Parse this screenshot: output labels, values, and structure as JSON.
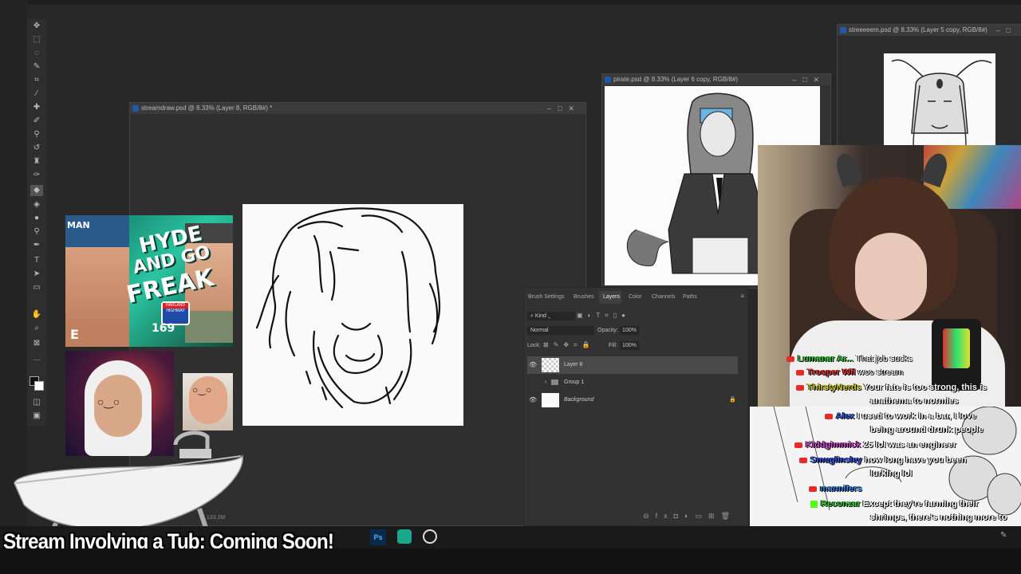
{
  "doc_windows": {
    "streamdraw": {
      "title": "streamdraw.psd @ 8.33% (Layer 8, RGB/8#) *",
      "status": "133.2M"
    },
    "pirate": {
      "title": "pirate.psd @ 8.33% (Layer 6 copy, RGB/8#)"
    },
    "streeeeem": {
      "title": "streeeeem.psd @ 8.33% (Layer 5 copy, RGB/8#)"
    }
  },
  "panel": {
    "tabs": [
      "Brush Settings",
      "Brushes",
      "Layers",
      "Color",
      "Channels",
      "Paths"
    ],
    "active_tab": "Layers",
    "filter_kind": "Kind",
    "blend_mode": "Normal",
    "opacity_label": "Opacity:",
    "opacity_value": "100%",
    "lock_label": "Lock:",
    "fill_label": "Fill:",
    "fill_value": "100%",
    "layers": [
      {
        "name": "Layer 8",
        "visible": true,
        "selected": true
      },
      {
        "name": "Group 1",
        "visible": false,
        "selected": false
      },
      {
        "name": "Background",
        "visible": true,
        "selected": false
      }
    ]
  },
  "thumbnail": {
    "cap_text": "MAN",
    "title_line1": "HYDE",
    "title_line2": "AND GO",
    "title_line3": "FREAK",
    "badge_line1": "HARLAND",
    "badge_line2": "HIGHWAY",
    "episode": "169",
    "left_text": "E"
  },
  "chat": {
    "messages": [
      {
        "platform": "youtube",
        "user": "Lumanar Ar...",
        "text": "That job sucks",
        "user_color": "#3ad13a"
      },
      {
        "platform": "youtube",
        "user": "Trooper Wil",
        "text": "woo stream",
        "user_color": "#e63939"
      },
      {
        "platform": "youtube",
        "user": "ThirstyNerds",
        "text": "Your fate is too strong, this is",
        "user_color": "#d8d02a"
      },
      {
        "platform": "none",
        "user": "",
        "text": "anathema to normies",
        "user_color": "#ffffff"
      },
      {
        "platform": "youtube",
        "user": "Alex",
        "text": "I used to work in a bar, I love",
        "user_color": "#3a5ae6"
      },
      {
        "platform": "none",
        "user": "",
        "text": "being around drunk people",
        "user_color": "#ffffff"
      },
      {
        "platform": "youtube",
        "user": "Kiddgimmick",
        "text": "25 lol was an engineer",
        "user_color": "#d84ad8"
      },
      {
        "platform": "youtube",
        "user": "Smuglinsley",
        "text": "how long have you been",
        "user_color": "#3a5ae6"
      },
      {
        "platform": "none",
        "user": "",
        "text": "lurking lol",
        "user_color": "#ffffff"
      },
      {
        "platform": "youtube",
        "user": "mannifers",
        "text": "",
        "user_color": "#3a8ae6"
      },
      {
        "platform": "kick",
        "user": "Reconzar",
        "text": "Except they're farming their",
        "user_color": "#3ad13a"
      },
      {
        "platform": "none",
        "user": "",
        "text": "shrimps, there's nothing more to",
        "user_color": "#ffffff"
      },
      {
        "platform": "none",
        "user": "",
        "text": "it",
        "user_color": "#ffffff"
      }
    ]
  },
  "banner": {
    "text": "Stream Involving a Tub: Coming Soon!"
  },
  "colors": {
    "accent": "#1e5aa8",
    "chat_green": "#3ad13a",
    "yt_red": "#e52d27"
  }
}
